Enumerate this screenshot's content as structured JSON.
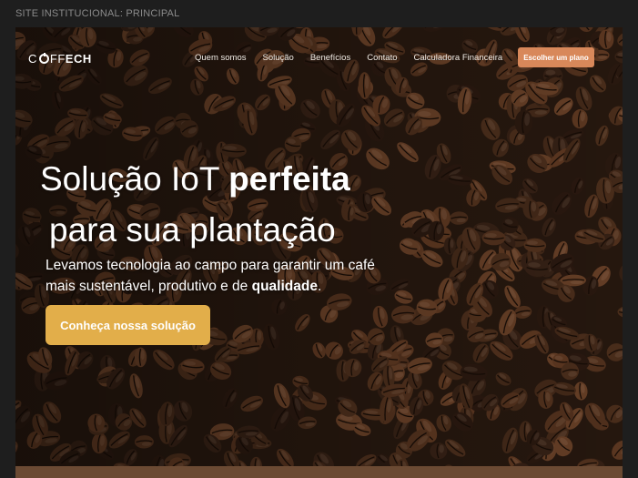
{
  "frame": {
    "label": "SITE INSTITUCIONAL: PRINCIPAL"
  },
  "nav": {
    "logo": {
      "prefix": "C",
      "middle": "FF",
      "suffix": "ECH"
    },
    "links": [
      "Quem somos",
      "Solução",
      "Benefícios",
      "Contato",
      "Calculadora Financeira"
    ],
    "cta": "Escolher um plano"
  },
  "hero": {
    "title_line1_a": "Solução IoT ",
    "title_line1_b": "perfeita",
    "title_line2": "para sua plantação",
    "subtitle_a": "Levamos tecnologia ao campo para garantir um café mais sustentável, produtivo e de ",
    "subtitle_b": "qualidade",
    "subtitle_c": ".",
    "button": "Conheça nossa solução"
  },
  "colors": {
    "accent_orange": "#d8885a",
    "accent_gold": "#e2ae4a",
    "background": "#1e1e1e"
  }
}
